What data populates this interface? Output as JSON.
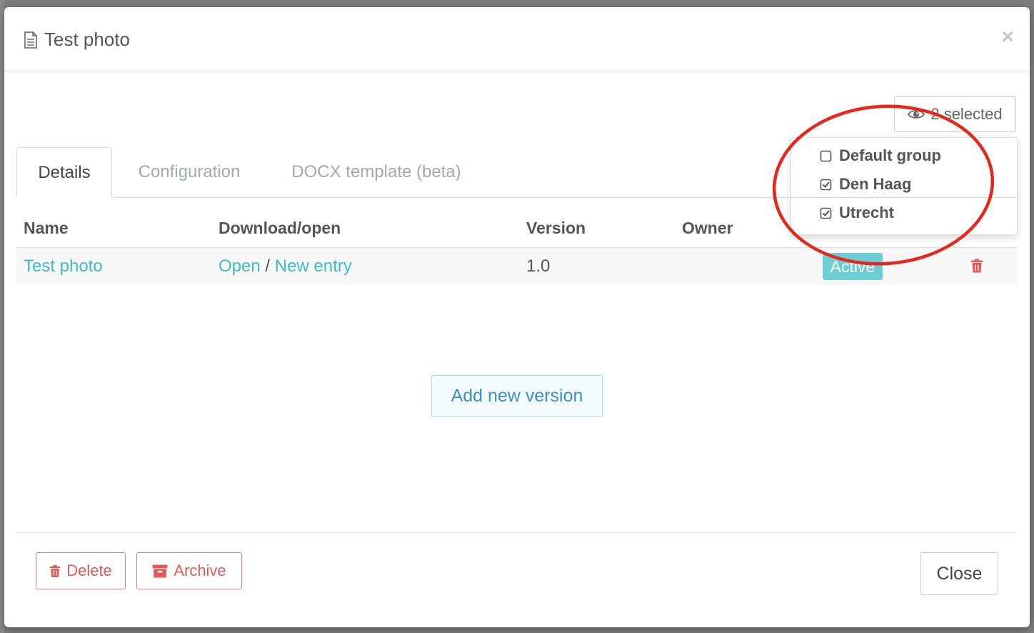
{
  "modal": {
    "title": "Test photo",
    "close_symbol": "×"
  },
  "group_selector": {
    "label": "2 selected",
    "icon": "eye-icon",
    "options": [
      {
        "label": "Default group",
        "checked": false
      },
      {
        "label": "Den Haag",
        "checked": true
      },
      {
        "label": "Utrecht",
        "checked": true
      }
    ]
  },
  "tabs": [
    {
      "label": "Details",
      "active": true
    },
    {
      "label": "Configuration",
      "active": false
    },
    {
      "label": "DOCX template (beta)",
      "active": false
    }
  ],
  "table": {
    "headers": [
      "Name",
      "Download/open",
      "Version",
      "Owner"
    ],
    "rows": [
      {
        "name": "Test photo",
        "open_label": "Open",
        "separator": "/",
        "new_entry_label": "New entry",
        "version": "1.0",
        "owner": "",
        "status": "Active"
      }
    ]
  },
  "actions": {
    "add_version": "Add new version",
    "delete": "Delete",
    "archive": "Archive",
    "close": "Close"
  },
  "colors": {
    "accent": "#3fbbc4",
    "status_active": "#6ccdd5",
    "danger": "#e05c5c",
    "annotation": "#e8261a"
  }
}
